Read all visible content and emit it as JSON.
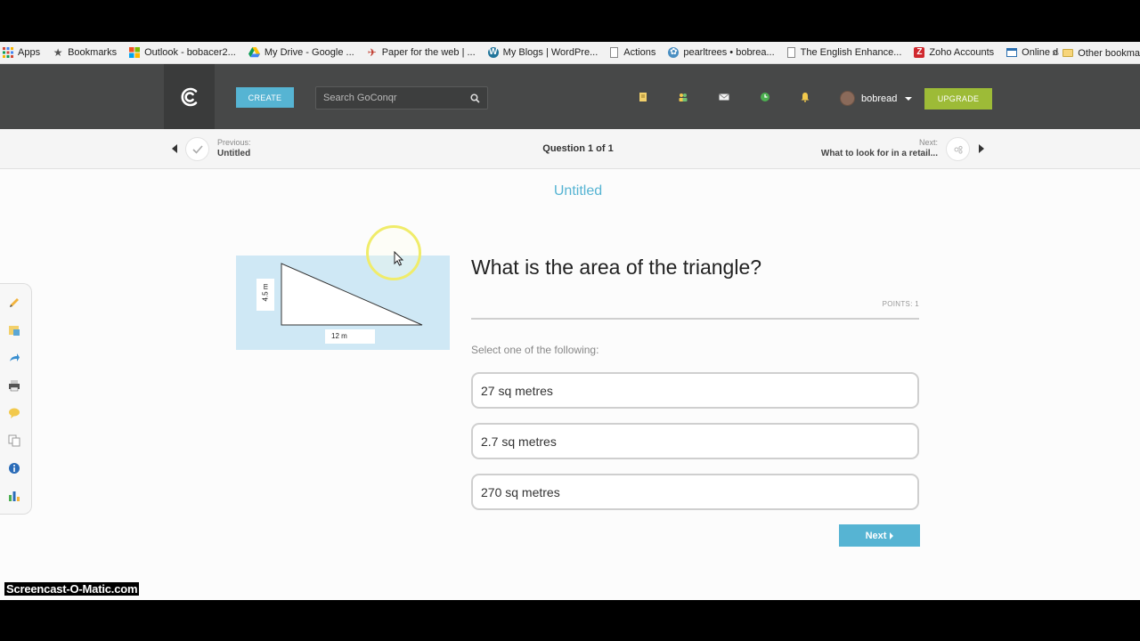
{
  "bookmarks": {
    "items": [
      {
        "label": "Apps",
        "icon": "apps-grid-icon"
      },
      {
        "label": "Bookmarks",
        "icon": "star-icon"
      },
      {
        "label": "Outlook - bobacer2...",
        "icon": "windows-icon"
      },
      {
        "label": "My Drive - Google ...",
        "icon": "google-drive-icon"
      },
      {
        "label": "Paper for the web | ...",
        "icon": "paper-bird-icon"
      },
      {
        "label": "My Blogs | WordPre...",
        "icon": "wordpress-icon"
      },
      {
        "label": "Actions",
        "icon": "page-icon"
      },
      {
        "label": "pearltrees • bobrea...",
        "icon": "pearltrees-icon"
      },
      {
        "label": "The English Enhance...",
        "icon": "page-icon"
      },
      {
        "label": "Zoho Accounts",
        "icon": "zoho-icon"
      },
      {
        "label": "Online database ap...",
        "icon": "database-icon"
      }
    ],
    "more": "»",
    "other": "Other bookma"
  },
  "header": {
    "create_label": "CREATE",
    "search_placeholder": "Search GoConqr",
    "username": "bobread",
    "upgrade_label": "UPGRADE"
  },
  "qnav": {
    "previous_small": "Previous:",
    "previous_title": "Untitled",
    "counter": "Question 1 of 1",
    "next_small": "Next:",
    "next_title": "What to look for in a retail..."
  },
  "quiz": {
    "title": "Untitled",
    "question": "What is the area of the triangle?",
    "points": "POINTS: 1",
    "instruction": "Select one of the following:",
    "options": [
      "27 sq metres",
      "2.7 sq metres",
      "270 sq metres"
    ],
    "next_label": "Next",
    "diagram": {
      "height_label": "4.5 m",
      "base_label": "12 m"
    }
  },
  "watermark": "Screencast-O-Matic.com",
  "colors": {
    "accent": "#56b4d3",
    "upgrade": "#9dbb37",
    "header_bg": "#474848"
  }
}
